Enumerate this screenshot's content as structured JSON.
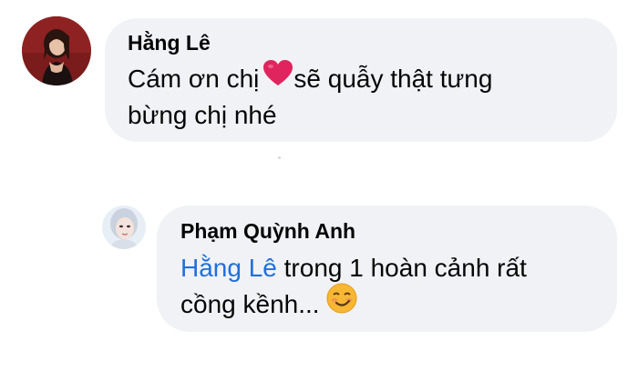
{
  "comments": [
    {
      "author": "Hằng Lê",
      "text_line1": "Cám ơn chị",
      "text_line1_after": "sẽ quẫy thật tưng",
      "text_line2": "bừng chị nhé",
      "icon": "red-heart-icon"
    },
    {
      "author": "Phạm Quỳnh Anh",
      "mention": "Hằng Lê",
      "text_line1_after": " trong 1 hoàn cảnh rất",
      "text_line2": "cồng kềnh... ",
      "icon": "smirking-face-icon"
    }
  ],
  "colors": {
    "bubble": "#f0f2f5",
    "mention": "#216fdb",
    "heart": "#e0245e",
    "emoji": "#f7b733"
  }
}
